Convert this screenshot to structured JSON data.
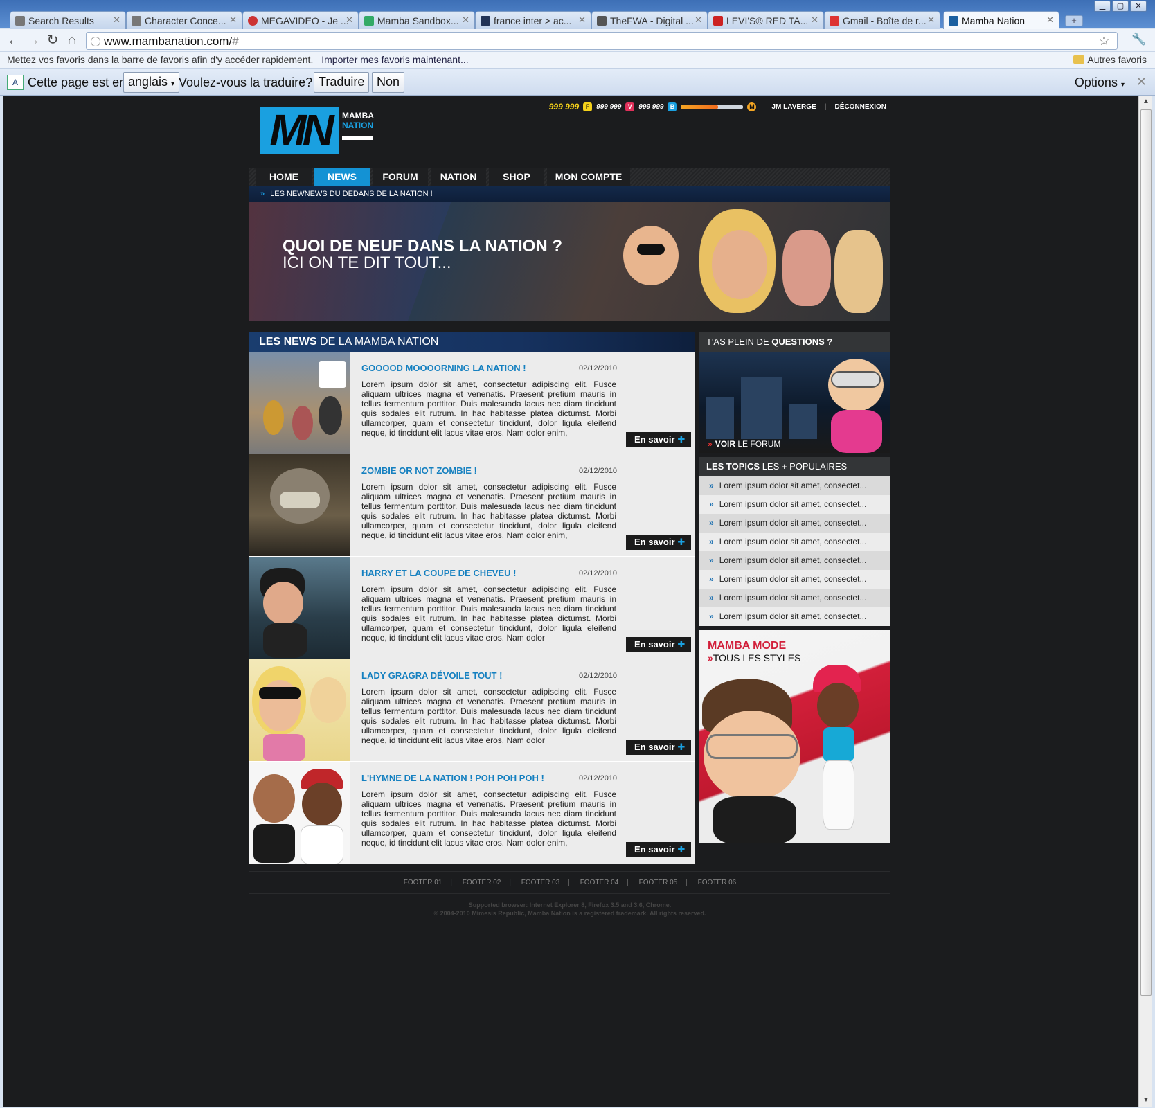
{
  "browser": {
    "tabs": [
      {
        "title": "Search Results"
      },
      {
        "title": "Character Conce..."
      },
      {
        "title": "MEGAVIDEO - Je ..."
      },
      {
        "title": "Mamba Sandbox..."
      },
      {
        "title": "france inter > ac..."
      },
      {
        "title": "TheFWA - Digital ..."
      },
      {
        "title": "LEVI'S® RED TA..."
      },
      {
        "title": "Gmail - Boîte de r..."
      },
      {
        "title": "Mamba Nation"
      }
    ],
    "url": "www.mambanation.com/",
    "url_hash": "#",
    "bookmarks_bar": {
      "message": "Mettez vos favoris dans la barre de favoris afin d'y accéder rapidement.",
      "import_link": "Importer mes favoris maintenant...",
      "other": "Autres favoris"
    },
    "translate_bar": {
      "prefix": "Cette page est en",
      "language": "anglais",
      "question": "Voulez-vous la traduire?",
      "translate_btn": "Traduire",
      "no_btn": "Non",
      "options": "Options"
    }
  },
  "site": {
    "logo": {
      "mark": "MN",
      "word1": "MAMBA",
      "word2": "NATION"
    },
    "userbar": {
      "stat1": "999 999",
      "stat2": "999 999",
      "stat3": "999 999",
      "xp_fraction": 0.6,
      "user": "JM LAVERGE",
      "logout": "DÉCONNEXION"
    },
    "nav": [
      "HOME",
      "NEWS",
      "FORUM",
      "NATION",
      "SHOP",
      "MON COMPTE"
    ],
    "nav_active": "NEWS",
    "subnav": "LES NEWNEWS DU DEDANS DE LA NATION !",
    "hero": {
      "line1": "QUOI DE NEUF DANS LA NATION ?",
      "line2": "ICI ON TE DIT TOUT..."
    },
    "news_header": {
      "bold": "LES NEWS",
      "rest": "DE LA MAMBA NATION"
    },
    "news": [
      {
        "title": "GOOOOD MOOOORNING LA NATION !",
        "date": "02/12/2010",
        "body": "Lorem ipsum dolor sit amet, consectetur adipiscing elit. Fusce aliquam ultrices magna et venenatis. Praesent pretium mauris in tellus fermentum porttitor. Duis malesuada lacus nec diam tincidunt quis sodales elit rutrum. In hac habitasse platea dictumst. Morbi ullamcorper, quam et consectetur tincidunt, dolor ligula eleifend neque, id tincidunt elit lacus vitae eros. Nam dolor enim,",
        "more": "En savoir"
      },
      {
        "title": "ZOMBIE OR NOT ZOMBIE !",
        "date": "02/12/2010",
        "body": "Lorem ipsum dolor sit amet, consectetur adipiscing elit. Fusce aliquam ultrices magna et venenatis. Praesent pretium mauris in tellus fermentum porttitor. Duis malesuada lacus nec diam tincidunt quis sodales elit rutrum. In hac habitasse platea dictumst. Morbi ullamcorper, quam et consectetur tincidunt, dolor ligula eleifend neque, id tincidunt elit lacus vitae eros. Nam dolor enim,",
        "more": "En savoir"
      },
      {
        "title": "HARRY ET LA COUPE DE CHEVEU !",
        "date": "02/12/2010",
        "body": "Lorem ipsum dolor sit amet, consectetur adipiscing elit. Fusce aliquam ultrices magna et venenatis. Praesent pretium mauris in tellus fermentum porttitor. Duis malesuada lacus nec diam tincidunt quis sodales elit rutrum. In hac habitasse platea dictumst. Morbi ullamcorper, quam et consectetur tincidunt, dolor ligula eleifend neque, id tincidunt elit lacus vitae eros. Nam dolor",
        "more": "En savoir"
      },
      {
        "title": "LADY GRAGRA DÉVOILE TOUT !",
        "date": "02/12/2010",
        "body": "Lorem ipsum dolor sit amet, consectetur adipiscing elit. Fusce aliquam ultrices magna et venenatis. Praesent pretium mauris in tellus fermentum porttitor. Duis malesuada lacus nec diam tincidunt quis sodales elit rutrum. In hac habitasse platea dictumst. Morbi ullamcorper, quam et consectetur tincidunt, dolor ligula eleifend neque, id tincidunt elit lacus vitae eros. Nam dolor",
        "more": "En savoir"
      },
      {
        "title": "L'HYMNE DE LA NATION ! POH POH POH !",
        "date": "02/12/2010",
        "body": "Lorem ipsum dolor sit amet, consectetur adipiscing elit. Fusce aliquam ultrices magna et venenatis. Praesent pretium mauris in tellus fermentum porttitor. Duis malesuada lacus nec diam tincidunt quis sodales elit rutrum. In hac habitasse platea dictumst. Morbi ullamcorper, quam et consectetur tincidunt, dolor ligula eleifend neque, id tincidunt elit lacus vitae eros. Nam dolor enim,",
        "more": "En savoir"
      }
    ],
    "sidebar": {
      "questions_head_pre": "T'AS PLEIN DE",
      "questions_head_bold": "QUESTIONS ?",
      "forum_link_bold": "VOIR",
      "forum_link_rest": "LE FORUM",
      "topics_head_bold": "LES TOPICS",
      "topics_head_rest": "LES + POPULAIRES",
      "topics": [
        "Lorem ipsum dolor sit amet, consectet...",
        "Lorem ipsum dolor sit amet, consectet...",
        "Lorem ipsum dolor sit amet, consectet...",
        "Lorem ipsum dolor sit amet, consectet...",
        "Lorem ipsum dolor sit amet, consectet...",
        "Lorem ipsum dolor sit amet, consectet...",
        "Lorem ipsum dolor sit amet, consectet...",
        "Lorem ipsum dolor sit amet, consectet..."
      ],
      "mode_title": "MAMBA MODE",
      "mode_sub": "TOUS LES STYLES"
    },
    "footer": {
      "links": [
        "FOOTER 01",
        "FOOTER 02",
        "FOOTER 03",
        "FOOTER 04",
        "FOOTER 05",
        "FOOTER 06"
      ],
      "supported": "Supported browser: Internet Explorer 8, Firefox 3.5 and 3.6, Chrome.",
      "copyright": "© 2004-2010 Mimesis Republic, Mamba Nation is a registered trademark. All rights reserved."
    }
  },
  "colors": {
    "accent": "#1492d4",
    "news_title": "#1580c0",
    "mode_red": "#d21f3a"
  }
}
